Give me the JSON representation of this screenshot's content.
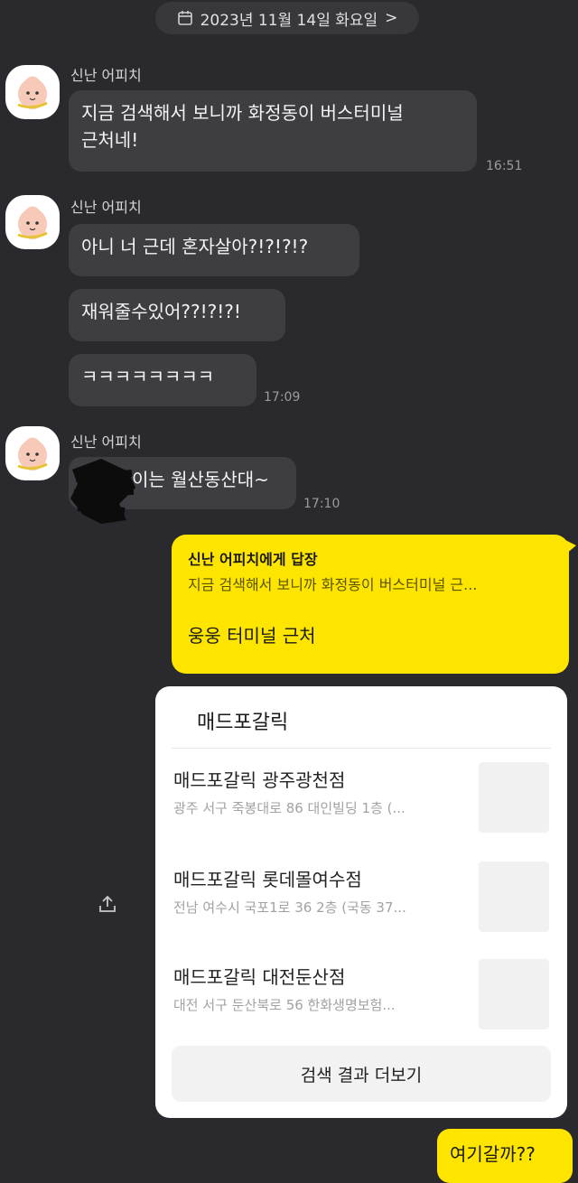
{
  "date_header": {
    "text": "2023년 11월 14일 화요일",
    "chevron": ">"
  },
  "sender_name": "신난 어피치",
  "groups": [
    {
      "messages": [
        "지금 검색해서 보니까 화정동이 버스터미널",
        "근처네!"
      ],
      "time": "16:51"
    },
    {
      "messages": [
        "아니 너 근데 혼자살아?!?!?!?",
        "재워줄수있어??!?!?!",
        "ㅋㅋㅋㅋㅋㅋㅋㅋ"
      ],
      "time": "17:09"
    },
    {
      "messages": [
        "이는 월산동산대~"
      ],
      "time": "17:10"
    }
  ],
  "reply": {
    "title": "신난 어피치에게 답장",
    "quote": "지금 검색해서 보니까 화정동이 버스터미널 근...",
    "message": "웅웅 터미널 근처"
  },
  "search_card": {
    "title": "매드포갈릭",
    "results": [
      {
        "name": "매드포갈릭 광주광천점",
        "address": "광주 서구 죽봉대로 86 대인빌딩 1층 (..."
      },
      {
        "name": "매드포갈릭 롯데몰여수점",
        "address": "전남 여수시 국포1로 36 2층 (국동 37..."
      },
      {
        "name": "매드포갈릭 대전둔산점",
        "address": "대전 서구 둔산북로 56 한화생명보험..."
      }
    ],
    "more_button": "검색 결과 더보기"
  },
  "bottom_message": "여기갈까??",
  "icons": [
    "calendar-icon",
    "chevron-right-icon",
    "apeach-avatar-icon",
    "share-icon"
  ],
  "colors": {
    "background": "#2a2a2e",
    "bubble": "#3d3d42",
    "my_bubble": "#fee500",
    "card": "#ffffff"
  }
}
